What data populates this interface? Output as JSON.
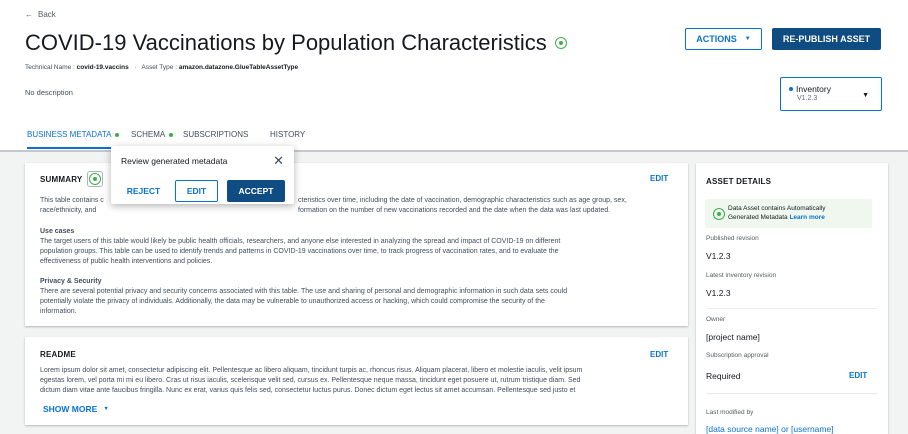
{
  "header": {
    "back_label": "Back",
    "title": "COVID-19 Vaccinations by Population Characteristics",
    "actions_label": "ACTIONS",
    "republish_label": "RE-PUBLISH ASSET",
    "technical_name_label": "Technical Name :",
    "technical_name": "covid-19.vaccins",
    "asset_type_label": "Asset Type :",
    "asset_type": "amazon.datazone.GlueTableAssetType",
    "description": "No description"
  },
  "inventory_select": {
    "label": "Inventory",
    "version": "V1.2.3"
  },
  "tabs": [
    {
      "label": "BUSINESS METADATA",
      "active": true,
      "dot": true
    },
    {
      "label": "SCHEMA",
      "active": false,
      "dot": true
    },
    {
      "label": "SUBSCRIPTIONS",
      "active": false,
      "dot": false
    },
    {
      "label": "HISTORY",
      "active": false,
      "dot": false
    }
  ],
  "summary": {
    "heading": "SUMMARY",
    "edit_label": "EDIT",
    "line1_left": "This table contains c",
    "line1_right": "cteristics over time, including the date of vaccination, demographic characteristics such as age group, sex,",
    "line2_left": "race/ethnicity, and",
    "line2_right": "formation on the number of new vaccinations recorded and the date when the data was last updated.",
    "use_cases_title": "Use cases",
    "use_cases_lines": [
      "The target users of this table would likely be public health officials, researchers, and anyone else interested in analyzing the spread and impact of COVID-19 on different",
      "population groups. This table can be used to identify trends and patterns in COVID-19 vaccinations over time, to track progress of vaccination rates, and to evaluate the",
      "effectiveness of public health interventions and policies."
    ],
    "privacy_title": "Privacy & Security",
    "privacy_lines": [
      "There are several potential privacy and security concerns associated with this table. The use and sharing of personal and demographic information in such data sets could",
      "potentially violate the privacy of individuals. Additionally, the data may be vulnerable to unauthorized access or hacking, which could compromise the security of the",
      "information."
    ]
  },
  "readme": {
    "heading": "README",
    "edit_label": "EDIT",
    "lines": [
      "Lorem ipsum dolor sit amet, consectetur adipiscing elit. Pellentesque ac libero aliquam, tincidunt turpis ac, rhoncus risus. Aliquam placerat, libero et molestie iaculis, velit ipsum",
      "egestas lorem, vel porta mi mi eu libero. Cras ut risus iaculis, scelerisque velit sed, cursus ex. Pellentesque neque massa, tincidunt eget posuere ut, rutrum tristique diam. Sed",
      "dictum diam vitae ante faucibus fringilla. Nunc ex erat, varius quis felis sed, consectetur luctus purus. Donec dictum eget lectus sit amet accumsan. Pellentesque sed justo et"
    ],
    "show_more_label": "SHOW MORE"
  },
  "popover": {
    "title": "Review generated metadata",
    "reject_label": "REJECT",
    "edit_label": "EDIT",
    "accept_label": "ACCEPT"
  },
  "asset_details": {
    "heading": "ASSET DETAILS",
    "alert_text": "Data Asset contains Automatically",
    "alert_text2": "Generated Metadata",
    "alert_link": "Learn more",
    "published_revision_label": "Published revision",
    "published_revision": "V1.2.3",
    "latest_inventory_label": "Latest inventory revision",
    "latest_inventory": "V1.2.3",
    "owner_label": "Owner",
    "owner": "[project name]",
    "subscription_label": "Subscription approval",
    "subscription": "Required",
    "subscription_edit": "EDIT",
    "modified_label": "Last modified by",
    "modified_by": "[data source name] or [username]"
  },
  "colors": {
    "accent": "#0972d3",
    "primary_button": "#0f4c81",
    "ai_green": "#3fae49"
  }
}
